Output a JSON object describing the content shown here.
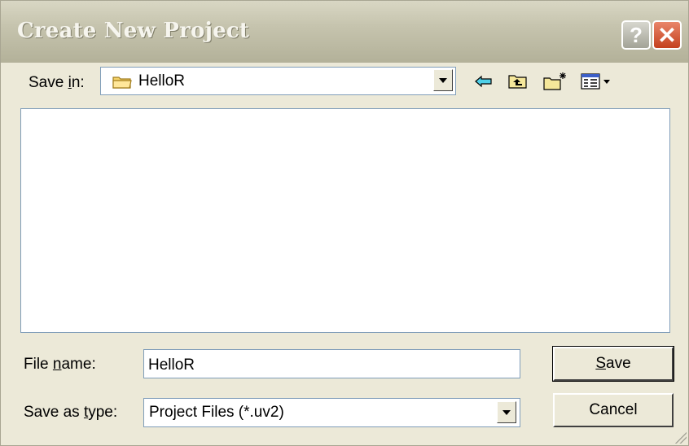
{
  "dialog": {
    "title": "Create New Project",
    "help_glyph": "?",
    "close_glyph": "✕"
  },
  "save_in": {
    "label_pre": "Save ",
    "label_accel": "i",
    "label_post": "n:",
    "value": "HelloR",
    "folder_icon": "folder-icon"
  },
  "toolbar": {
    "back_icon": "back-arrow-icon",
    "up_icon": "up-folder-icon",
    "new_folder_icon": "new-folder-icon",
    "view_icon": "view-menu-icon"
  },
  "file_list": {
    "items": []
  },
  "file_name": {
    "label_pre": "File ",
    "label_accel": "n",
    "label_post": "ame:",
    "value": "HelloR"
  },
  "save_as_type": {
    "label_pre": "Save as ",
    "label_accel": "t",
    "label_post": "ype:",
    "value": "Project Files (*.uv2)"
  },
  "buttons": {
    "save_accel": "S",
    "save_rest": "ave",
    "cancel": "Cancel"
  },
  "colors": {
    "window_bg": "#ece9d8",
    "titlebar": "#c6c4ae",
    "close_red": "#d2552f",
    "input_border": "#7f9db9",
    "toolbar_accent": "#00a0c8"
  }
}
